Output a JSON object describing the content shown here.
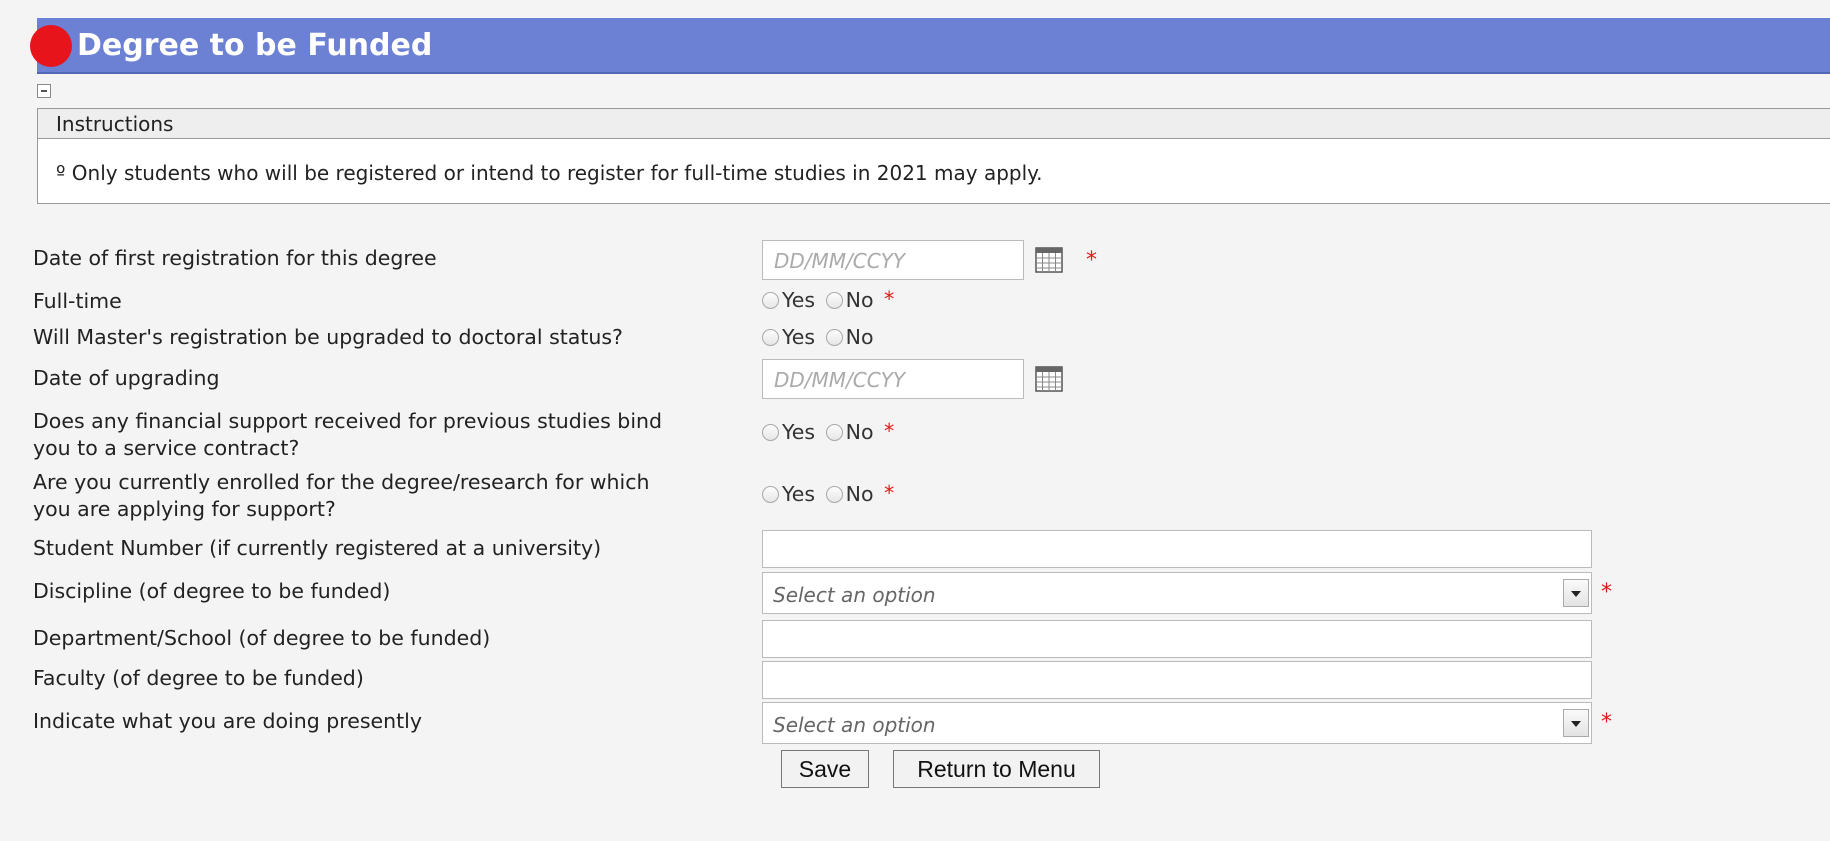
{
  "header": {
    "title": "Degree to be Funded"
  },
  "instructions": {
    "heading": "Instructions",
    "text": "º Only students who will be registered or intend to register for full-time studies in 2021 may apply."
  },
  "form": {
    "required_mark": "*",
    "date_placeholder": "DD/MM/CCYY",
    "select_placeholder": "Select an option",
    "yes_label": "Yes",
    "no_label": "No",
    "fields": {
      "first_registration": "Date of first registration for this degree",
      "full_time": "Full-time",
      "upgrade": "Will Master's registration be upgraded to doctoral status?",
      "date_upgrading": "Date of upgrading",
      "service_contract_1": "Does any financial support received for previous studies bind",
      "service_contract_2": "you to a service contract?",
      "enrolled_1": "Are you currently enrolled for the degree/research for which",
      "enrolled_2": "you are applying for support?",
      "student_number": "Student Number (if currently registered at a university)",
      "discipline": "Discipline (of degree to be funded)",
      "department": "Department/School (of degree to be funded)",
      "faculty": "Faculty (of degree to be funded)",
      "doing_presently": "Indicate what you are doing presently"
    }
  },
  "buttons": {
    "save": "Save",
    "return": "Return to Menu"
  },
  "colors": {
    "header_bg": "#6c80d4",
    "required": "#e01818",
    "dot": "#e8141c"
  }
}
